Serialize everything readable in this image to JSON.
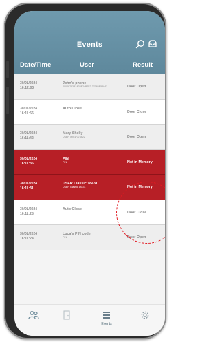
{
  "header": {
    "title": "Events",
    "columns": {
      "date": "Date/Time",
      "user": "User",
      "result": "Result"
    }
  },
  "events": [
    {
      "date": "30/01/2024",
      "time": "16:12:03",
      "user": "John's phone",
      "user_sub": "40048783B3A34F24B7E3 37085B53843",
      "result": "Door Open",
      "alert": false
    },
    {
      "date": "30/01/2024",
      "time": "16:11:56",
      "user": "Auto Close",
      "user_sub": "",
      "result": "Door Close",
      "alert": false
    },
    {
      "date": "30/01/2024",
      "time": "16:11:42",
      "user": "Mary Shelly",
      "user_sub": "USER 5K61FA 6822",
      "result": "Door Open",
      "alert": false
    },
    {
      "date": "30/01/2024",
      "time": "16:11:36",
      "user": "PIN",
      "user_sub": "PIN",
      "result": "Not in Memory",
      "alert": true
    },
    {
      "date": "30/01/2024",
      "time": "16:11:31",
      "user": "USER Classic 18431",
      "user_sub": "USER Classic 18431",
      "result": "Not in Memory",
      "alert": true
    },
    {
      "date": "30/01/2024",
      "time": "16:11:28",
      "user": "Auto Close",
      "user_sub": "",
      "result": "Door Close",
      "alert": false
    },
    {
      "date": "30/01/2024",
      "time": "16:11:24",
      "user": "Luca's PIN code",
      "user_sub": "PIN",
      "result": "Door Open",
      "alert": false
    }
  ],
  "tabs": [
    {
      "icon": "users-icon",
      "label": ""
    },
    {
      "icon": "door-icon",
      "label": ""
    },
    {
      "icon": "events-icon",
      "label": "Events"
    },
    {
      "icon": "settings-icon",
      "label": ""
    }
  ],
  "colors": {
    "header": "#6f9aae",
    "alert": "#b71f26",
    "highlight_circle": "#e21a22"
  }
}
